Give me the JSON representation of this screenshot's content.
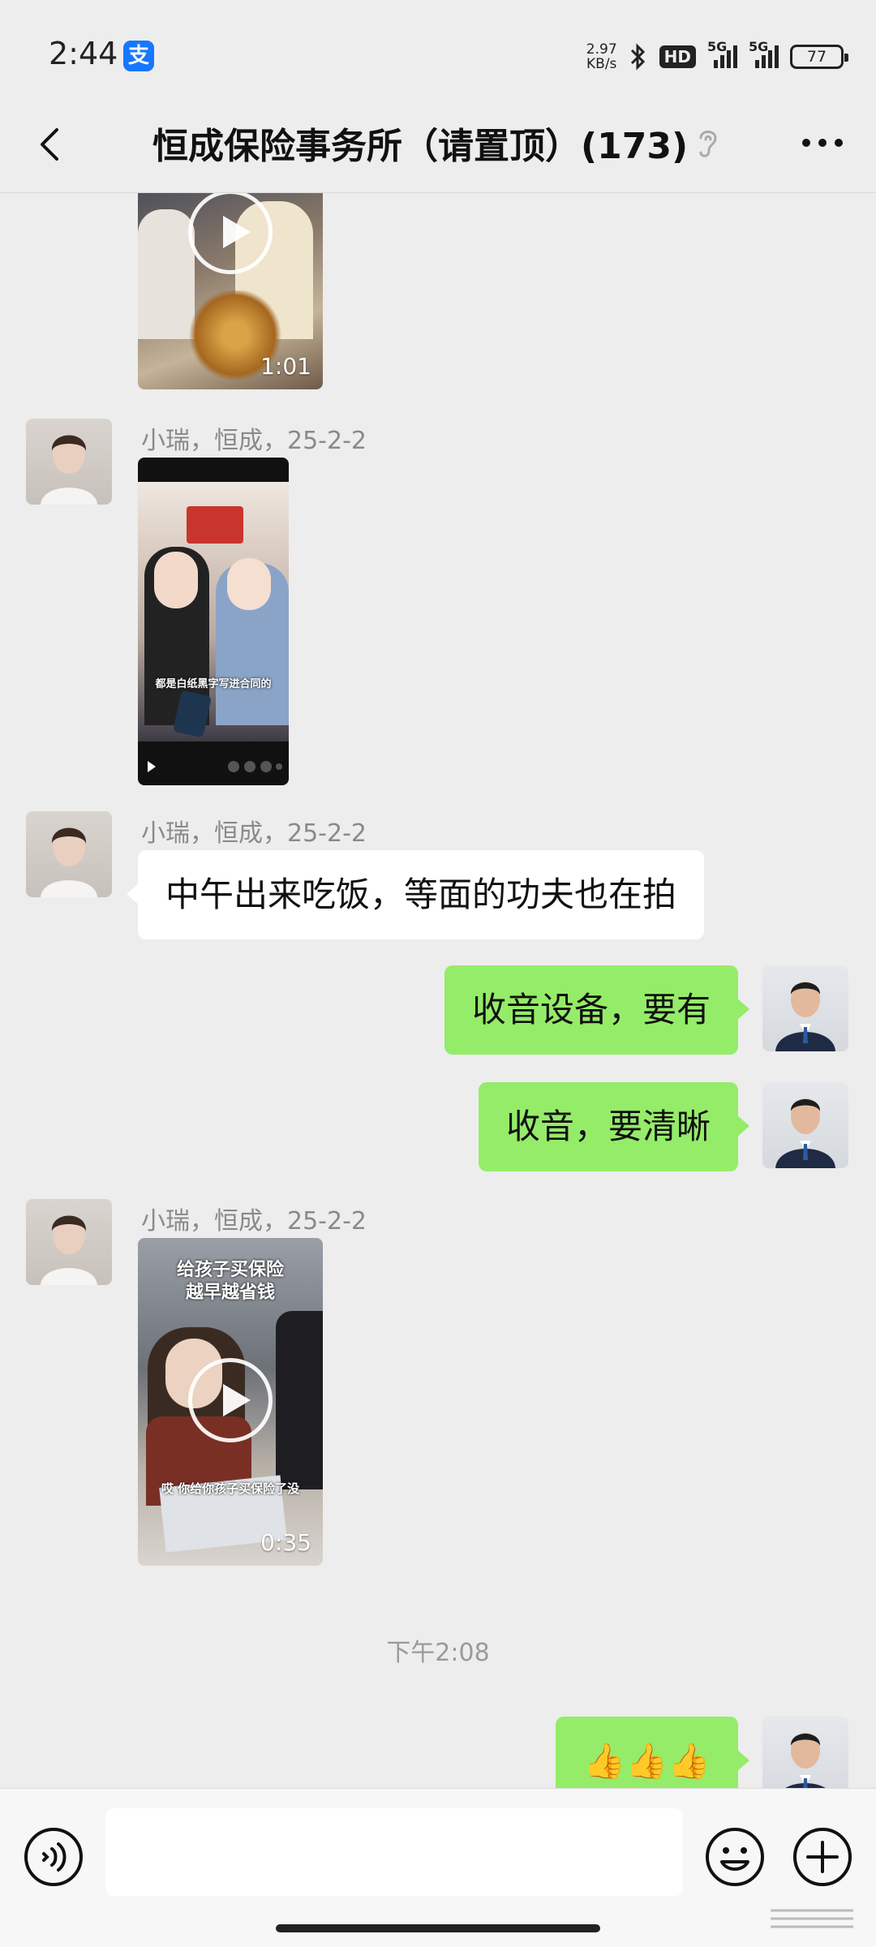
{
  "status_bar": {
    "time": "2:44",
    "app_badge": "支",
    "net_speed_value": "2.97",
    "net_speed_unit": "KB/s",
    "hd_badge": "HD",
    "signal_label_1": "5G",
    "signal_label_2": "5G",
    "battery": "77"
  },
  "header": {
    "title": "恒成保险事务所（请置顶）(173)"
  },
  "messages": {
    "video1": {
      "duration": "1:01"
    },
    "msg2": {
      "sender": "小瑞，恒成，25-2-2",
      "video_caption": "都是白纸黑字写进合同的"
    },
    "msg3": {
      "sender": "小瑞，恒成，25-2-2",
      "text": "中午出来吃饭，等面的功夫也在拍"
    },
    "msg4": {
      "text": "收音设备，要有"
    },
    "msg5": {
      "text": "收音，要清晰"
    },
    "msg6": {
      "sender": "小瑞，恒成，25-2-2",
      "video_title_line1": "给孩子买保险",
      "video_title_line2": "越早越省钱",
      "video_subtitle": "哎 你给你孩子买保险了没",
      "duration": "0:35"
    },
    "timestamp": "下午2:08",
    "msg7": {
      "text": "👍👍👍"
    }
  },
  "input_bar": {
    "placeholder": ""
  },
  "colors": {
    "background": "#ededed",
    "bubble_self": "#95ec69",
    "bubble_other": "#ffffff",
    "meta_text": "#8a8a8a"
  }
}
